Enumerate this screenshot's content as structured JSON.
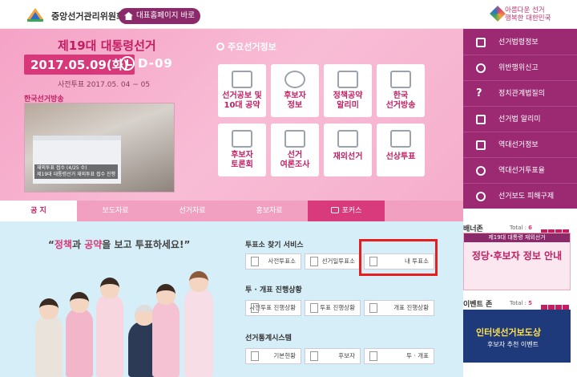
{
  "header": {
    "org_name": "중앙선거관리위원회",
    "home_button": "대표홈페이지 바로가기",
    "slogan_line1": "아름다운 선거",
    "slogan_line2": "행복한 대한민국"
  },
  "hero": {
    "election_title": "제19대 대통령선거",
    "election_date": "2017.05.09(화)",
    "dday": "D-09",
    "early_vote": "사전투표 2017.05. 04 ~ 05",
    "broadcast_label": "한국선거방송",
    "video_caption_line1": "재외투표 접수 (4/25 수)",
    "video_caption_line2": "제19대 대통령선거 재외투표 접수 진행"
  },
  "info": {
    "heading": "주요선거정보",
    "tiles": [
      {
        "label": "선거공보 및\n10대 공약"
      },
      {
        "label": "후보자\n정보"
      },
      {
        "label": "정책공약\n알리미"
      },
      {
        "label": "한국\n선거방송"
      },
      {
        "label": "후보자\n토론회"
      },
      {
        "label": "선거\n여론조사"
      },
      {
        "label": "재외선거"
      },
      {
        "label": "선상투표"
      }
    ]
  },
  "sidebar": {
    "items": [
      {
        "label": "선거법령정보",
        "icon": "gavel-icon"
      },
      {
        "label": "위반행위신고",
        "icon": "no-icon"
      },
      {
        "label": "정치관계법질의",
        "icon": "question-icon"
      },
      {
        "label": "선거법 알리미",
        "icon": "document-icon"
      },
      {
        "label": "역대선거정보",
        "icon": "monitor-icon"
      },
      {
        "label": "역대선거투표율",
        "icon": "group-icon"
      },
      {
        "label": "선거보도 피해구제",
        "icon": "person-icon"
      }
    ]
  },
  "tabs": [
    "공 지",
    "보도자료",
    "선거자료",
    "홍보자료",
    "포커스"
  ],
  "campaign": {
    "prefix": "“",
    "word1": "정책",
    "mid1": "과 ",
    "word2": "공약",
    "suffix": "을 보고 투표하세요!”"
  },
  "services": {
    "find_title": "투표소 찾기 서비스",
    "find_buttons": [
      "사전투표소",
      "선거일투표소",
      "내 투표소"
    ],
    "status_title": "투 · 개표 진행상황",
    "status_buttons": [
      "사전투표 진행상황",
      "투표 진행상황",
      "개표 진행상황"
    ],
    "stats_title": "선거통계시스템",
    "stats_buttons": [
      "기본현황",
      "후보자",
      "투 · 개표"
    ]
  },
  "right": {
    "banner_zone": "배너존",
    "banner_total_label": "Total : ",
    "banner_total": "6",
    "banner1_top": "제19대 대통령 재외선거",
    "banner1_big": "정당·후보자 정보 안내",
    "event_zone": "이벤트 존",
    "event_total_label": "Total : ",
    "event_total": "5",
    "banner2_big": "인터넷선거보도상",
    "banner2_small": "후보자 추천 이벤트"
  },
  "colors": {
    "brand": "#c21f63",
    "sidebar": "#9b2a73",
    "highlight_box": "#e61e1e"
  }
}
